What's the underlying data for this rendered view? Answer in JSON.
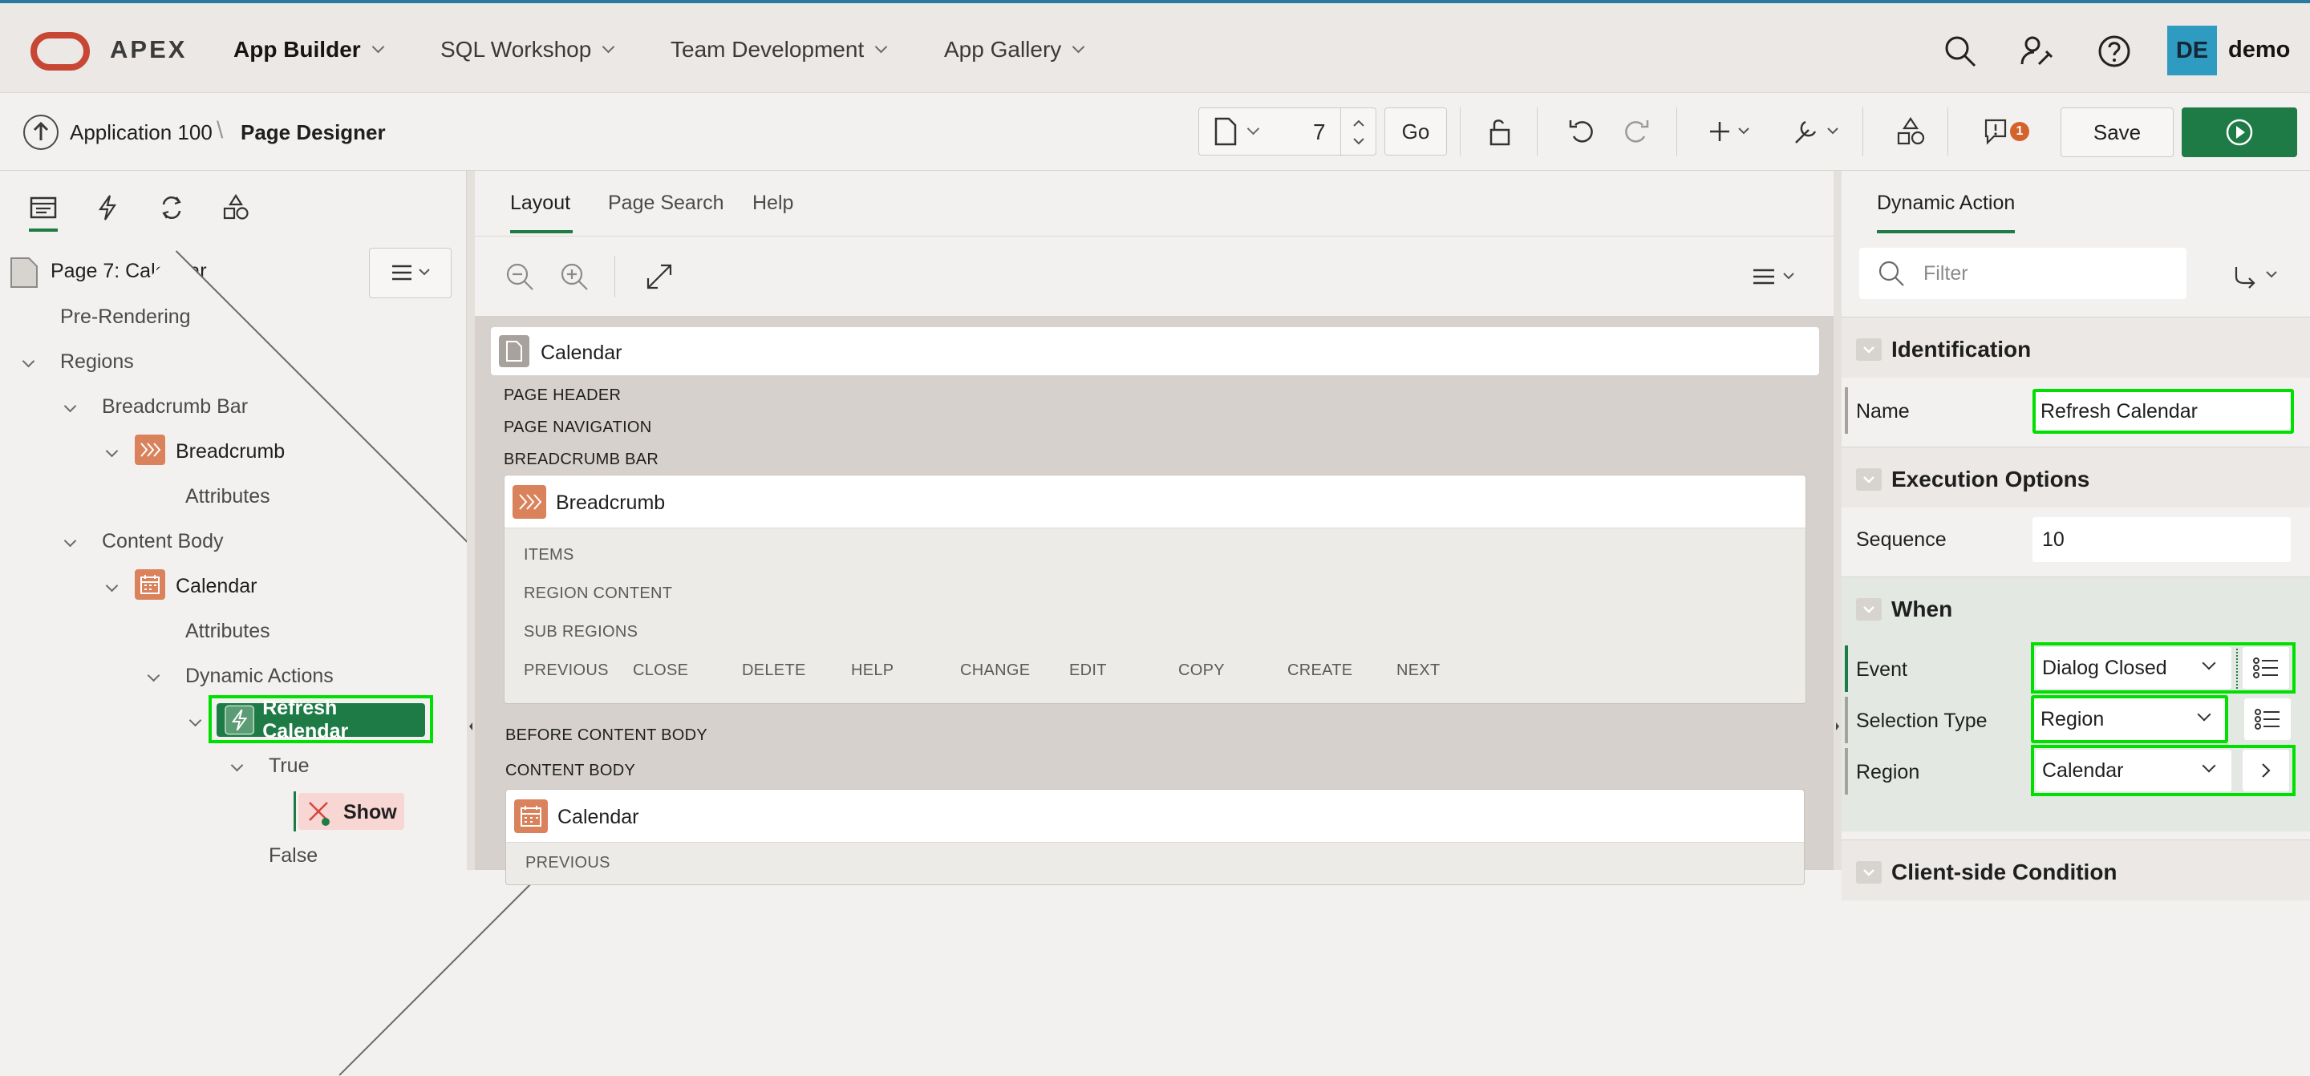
{
  "header": {
    "brand": "APEX",
    "nav": [
      {
        "label": "App Builder"
      },
      {
        "label": "SQL Workshop"
      },
      {
        "label": "Team Development"
      },
      {
        "label": "App Gallery"
      }
    ],
    "avatar_initials": "DE",
    "user": "demo"
  },
  "toolbar": {
    "breadcrumb_app": "Application 100",
    "breadcrumb_sep": "\\",
    "breadcrumb_page": "Page Designer",
    "page_number": "7",
    "go_label": "Go",
    "save_label": "Save",
    "issues_count": "1"
  },
  "left": {
    "page_title": "Page 7: Calendar",
    "tree": {
      "pre_rendering": "Pre-Rendering",
      "regions": "Regions",
      "breadcrumb_bar": "Breadcrumb Bar",
      "breadcrumb": "Breadcrumb",
      "attributes_1": "Attributes",
      "content_body": "Content Body",
      "calendar": "Calendar",
      "attributes_2": "Attributes",
      "dynamic_actions": "Dynamic Actions",
      "refresh_calendar": "Refresh Calendar",
      "true_label": "True",
      "show": "Show",
      "false_label": "False"
    }
  },
  "middle": {
    "tabs": [
      {
        "label": "Layout"
      },
      {
        "label": "Page Search"
      },
      {
        "label": "Help"
      }
    ],
    "page_box_title": "Calendar",
    "sections": {
      "page_header": "PAGE HEADER",
      "page_navigation": "PAGE NAVIGATION",
      "breadcrumb_bar": "BREADCRUMB BAR",
      "before_content_body": "BEFORE CONTENT BODY",
      "content_body": "CONTENT BODY"
    },
    "breadcrumb_region": {
      "title": "Breadcrumb",
      "items": "ITEMS",
      "region_content": "REGION CONTENT",
      "sub_regions": "SUB REGIONS",
      "buttons": [
        "PREVIOUS",
        "CLOSE",
        "DELETE",
        "HELP",
        "CHANGE",
        "EDIT",
        "COPY",
        "CREATE",
        "NEXT"
      ]
    },
    "calendar_region": {
      "title": "Calendar",
      "first_slot": "PREVIOUS"
    }
  },
  "right": {
    "tab": "Dynamic Action",
    "filter_placeholder": "Filter",
    "groups": {
      "identification": "Identification",
      "execution_options": "Execution Options",
      "when": "When",
      "client_side_condition": "Client-side Condition"
    },
    "props": {
      "name_label": "Name",
      "name_value": "Refresh Calendar",
      "sequence_label": "Sequence",
      "sequence_value": "10",
      "event_label": "Event",
      "event_value": "Dialog Closed",
      "selection_type_label": "Selection Type",
      "selection_type_value": "Region",
      "region_label": "Region",
      "region_value": "Calendar"
    }
  },
  "colors": {
    "accent": "#1e7b46",
    "highlight": "#00e000",
    "oracle_red": "#c74634",
    "component_orange": "#d9825c"
  }
}
